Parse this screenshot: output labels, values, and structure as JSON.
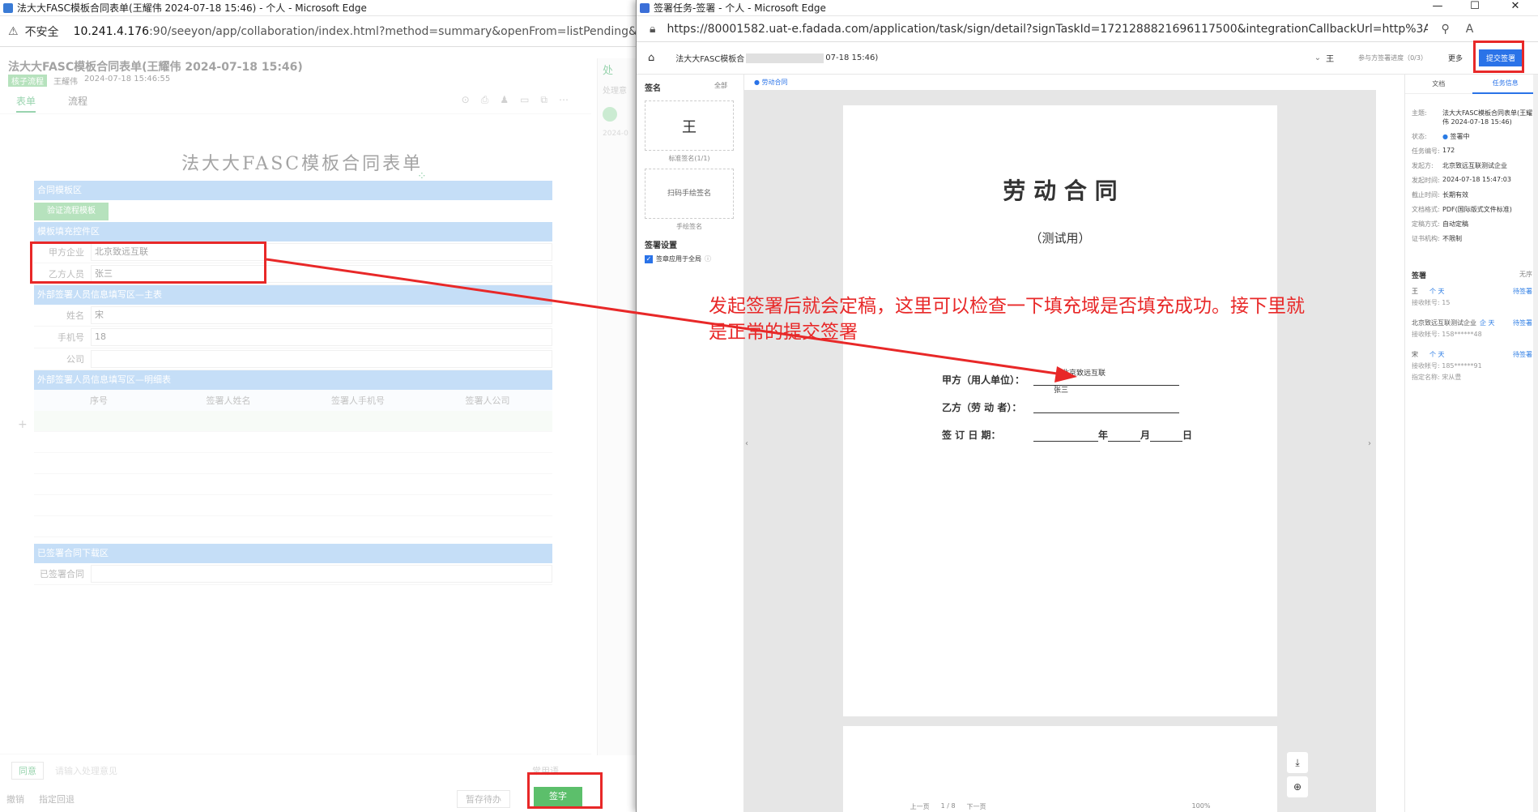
{
  "back_window": {
    "title": "法大大FASC模板合同表单(王耀伟 2024-07-18 15:46) - 个人 - Microsoft Edge",
    "insecure": "不安全",
    "url_host": "10.241.4.176",
    "url_rest": ":90/seeyon/app/collaboration/index.html?method=summary&openFrom=listPending&affairId=57",
    "heading": "法大大FASC模板合同表单(王耀伟 2024-07-18 15:46)",
    "badge": "核子流程",
    "author": "王耀伟",
    "time": "2024-07-18 15:46:55",
    "tabs": [
      "表单",
      "流程"
    ],
    "side_label": "处",
    "side_sub": "处理意",
    "side_date": "2024-0",
    "form_title": "法大大FASC模板合同表单",
    "sec1": "合同模板区",
    "sec1_btn": "验证流程模板",
    "sec2": "模板填充控件区",
    "fields": [
      {
        "label": "甲方企业",
        "value": "北京致远互联"
      },
      {
        "label": "乙方人员",
        "value": "张三"
      }
    ],
    "sec3": "外部签署人员信息填写区—主表",
    "sub_fields": [
      {
        "label": "姓名",
        "value": "宋"
      },
      {
        "label": "手机号",
        "value": "18"
      },
      {
        "label": "公司",
        "value": ""
      }
    ],
    "sec4": "外部签署人员信息填写区—明细表",
    "grid_headers": [
      "序号",
      "签署人姓名",
      "签署人手机号",
      "签署人公司"
    ],
    "sec5": "已签署合同下载区",
    "signed_label": "已签署合同",
    "agree": "同意",
    "comment_placeholder": "请输入处理意见",
    "common_words": "常用语",
    "revoke": "撤销",
    "return_label": "指定回退",
    "hold": "暂存待办",
    "sign_btn": "签字"
  },
  "front_window": {
    "title": "签署任务-签署 - 个人 - Microsoft Edge",
    "url": "https://80001582.uat-e.fadada.com/application/task/sign/detail?signTaskId=1721288821696117500&integrationCallbackUrl=http%3A%2F%2F10.241.4.176...",
    "task_title": "法大大FASC模板合",
    "task_date": "07-18 15:46)",
    "signer_short": "王",
    "progress": "参与方签署进度（0/3）",
    "more": "更多",
    "submit": "提交签署",
    "sign_section": "签名",
    "filter_all": "全部",
    "std_sign_name": "王",
    "std_sign_label": "标准签名(1/1)",
    "scan_hand": "扫码手绘签名",
    "hand_label": "手绘签名",
    "settings_title": "签署设置",
    "apply_all": "签章应用于全局",
    "doc_tab": "劳动合同",
    "right_tabs": [
      "文档",
      "任务信息"
    ],
    "info": [
      {
        "k": "主题:",
        "v": "法大大FASC模板合同表单(王耀伟 2024-07-18 15:46)"
      },
      {
        "k": "状态:",
        "v": "签署中"
      },
      {
        "k": "任务编号:",
        "v": "172"
      },
      {
        "k": "发起方:",
        "v": "北京致远互联测试企业"
      },
      {
        "k": "发起时间:",
        "v": "2024-07-18 15:47:03"
      },
      {
        "k": "截止时间:",
        "v": "长期有效"
      },
      {
        "k": "文档格式:",
        "v": "PDF(国际版式文件标准)"
      },
      {
        "k": "定稿方式:",
        "v": "自动定稿"
      },
      {
        "k": "证书机构:",
        "v": "不限制"
      }
    ],
    "signers_title": "签署",
    "no_order": "无序",
    "signers": [
      {
        "name": "王",
        "tag": "个 天",
        "status": "待签署",
        "acc_label": "接收帐号:",
        "acc": "15"
      },
      {
        "name": "北京致远互联测试企业",
        "tag": "企 天",
        "status": "待签署",
        "acc_label": "接收帐号:",
        "acc": "158******48"
      },
      {
        "name": "宋",
        "tag": "个 天",
        "status": "待签署",
        "acc_label": "接收帐号:",
        "acc": "185******91",
        "extra_label": "指定名称:",
        "extra": "宋从豊"
      }
    ],
    "doc": {
      "title": "劳 动 合 同",
      "subtitle": "（测试用）",
      "party_a_label": "甲方（用人单位）：",
      "party_a_value": "北京致远互联",
      "party_b_value": "张三",
      "party_b_label": "乙方（劳 动 者）：",
      "date_label": "签 订 日 期：",
      "year": "年",
      "month": "月",
      "day": "日"
    },
    "pager": {
      "prev": "上一页",
      "page": "1 / 8",
      "next": "下一页",
      "zoom": "100%"
    }
  },
  "annotation": {
    "line1": "发起签署后就会定稿，这里可以检查一下填充域是否填充成功。接下里就",
    "line2": "是正常的提交签署",
    "color": "#e82828"
  }
}
